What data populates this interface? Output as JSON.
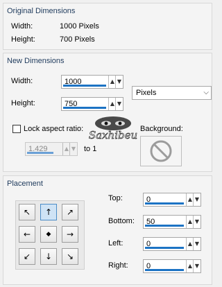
{
  "original": {
    "title": "Original Dimensions",
    "width_label": "Width:",
    "width_value": "1000 Pixels",
    "height_label": "Height:",
    "height_value": "700 Pixels"
  },
  "new_dims": {
    "title": "New Dimensions",
    "width_label": "Width:",
    "width_value": "1000",
    "height_label": "Height:",
    "height_value": "750",
    "units_selected": "Pixels",
    "lock_label": "Lock aspect ratio:",
    "ratio_value": "1.429",
    "ratio_suffix": "to 1",
    "background_label": "Background:"
  },
  "placement": {
    "title": "Placement",
    "top_label": "Top:",
    "top_value": "0",
    "bottom_label": "Bottom:",
    "bottom_value": "50",
    "left_label": "Left:",
    "left_value": "0",
    "right_label": "Right:",
    "right_value": "0",
    "arrows": [
      "↖",
      "↑",
      "↗",
      "←",
      "◆",
      "→",
      "↙",
      "↓",
      "↘"
    ],
    "active_arrow": 1
  },
  "colors": {
    "accent": "#1c73c4",
    "title": "#1e3a5c"
  },
  "watermark": "Saxhibeu"
}
